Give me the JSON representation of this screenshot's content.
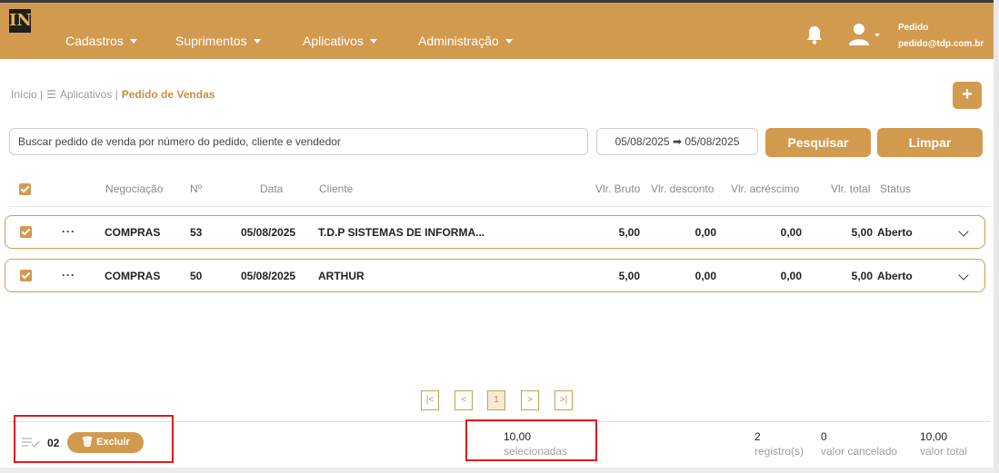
{
  "app": {
    "logo_text": "IN"
  },
  "nav": {
    "items": [
      {
        "label": "Cadastros"
      },
      {
        "label": "Suprimentos"
      },
      {
        "label": "Aplicativos"
      },
      {
        "label": "Administração"
      }
    ]
  },
  "user": {
    "name": "Pedido",
    "email": "pedido@tdp.com.br"
  },
  "breadcrumb": {
    "home": "Início |",
    "parent": "Aplicativos |",
    "current": "Pedido de Vendas"
  },
  "toolbar": {
    "add_label": "+"
  },
  "search": {
    "placeholder": "Buscar pedido de venda por número do pedido, cliente e vendedor",
    "date_range": "05/08/2025 ➡ 05/08/2025",
    "search_label": "Pesquisar",
    "clear_label": "Limpar"
  },
  "table": {
    "columns": {
      "negociacao": "Negociação",
      "numero": "Nº",
      "data": "Data",
      "cliente": "Cliente",
      "vlr_bruto": "Vlr. Bruto",
      "vlr_desconto": "Vlr. desconto",
      "vlr_acrescimo": "Vlr. acréscimo",
      "vlr_total": "Vlr. total",
      "status": "Status"
    },
    "rows": [
      {
        "menu": "···",
        "negociacao": "COMPRAS",
        "numero": "53",
        "data": "05/08/2025",
        "cliente": "T.D.P SISTEMAS DE INFORMA...",
        "vlr_bruto": "5,00",
        "vlr_desconto": "0,00",
        "vlr_acrescimo": "0,00",
        "vlr_total": "5,00",
        "status": "Aberto",
        "checked": true
      },
      {
        "menu": "···",
        "negociacao": "COMPRAS",
        "numero": "50",
        "data": "05/08/2025",
        "cliente": "ARTHUR",
        "vlr_bruto": "5,00",
        "vlr_desconto": "0,00",
        "vlr_acrescimo": "0,00",
        "vlr_total": "5,00",
        "status": "Aberto",
        "checked": true
      }
    ]
  },
  "pagination": {
    "first": "|<",
    "prev": "<",
    "current": "1",
    "next": ">",
    "last": ">|"
  },
  "footer": {
    "selected_count": "02",
    "delete_label": "Excluir",
    "selected_value": "10,00",
    "selected_label": "selecionadas",
    "records_value": "2",
    "records_label": "registro(s)",
    "cancelled_value": "0",
    "cancelled_label": "valor cancelado",
    "total_value": "10,00",
    "total_label": "valor total"
  },
  "colors": {
    "accent": "#d29a4f",
    "highlight_box": "#e01b1b"
  }
}
